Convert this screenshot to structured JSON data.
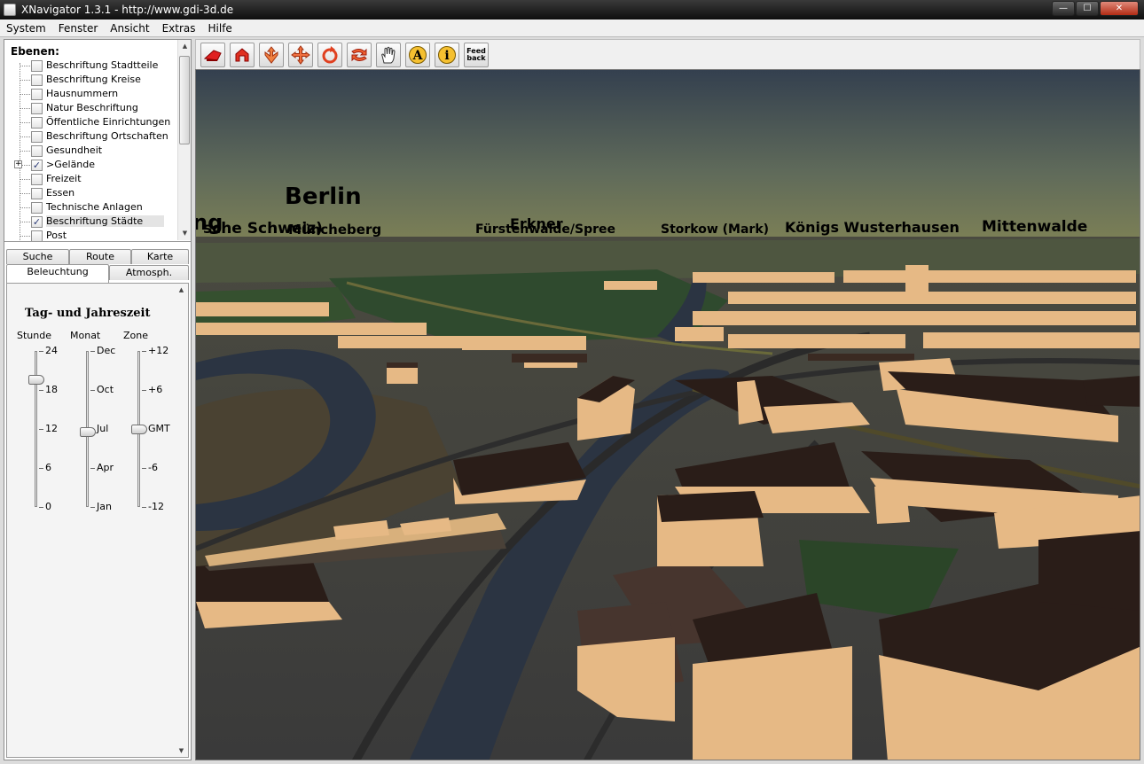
{
  "window": {
    "title": "XNavigator 1.3.1 - http://www.gdi-3d.de",
    "controls": {
      "minimize": "—",
      "maximize": "☐",
      "close": "✕"
    }
  },
  "menu": [
    "System",
    "Fenster",
    "Ansicht",
    "Extras",
    "Hilfe"
  ],
  "layers": {
    "title": "Ebenen:",
    "items": [
      {
        "label": "Beschriftung Stadtteile",
        "checked": false
      },
      {
        "label": "Beschriftung Kreise",
        "checked": false
      },
      {
        "label": "Hausnummern",
        "checked": false
      },
      {
        "label": "Natur Beschriftung",
        "checked": false
      },
      {
        "label": "Öffentliche Einrichtungen",
        "checked": false
      },
      {
        "label": "Beschriftung Ortschaften",
        "checked": false
      },
      {
        "label": "Gesundheit",
        "checked": false
      },
      {
        "label": ">Gelände",
        "checked": true,
        "expandable": true
      },
      {
        "label": "Freizeit",
        "checked": false
      },
      {
        "label": "Essen",
        "checked": false
      },
      {
        "label": "Technische Anlagen",
        "checked": false
      },
      {
        "label": "Beschriftung Städte",
        "checked": true,
        "selected": true
      },
      {
        "label": "Post",
        "checked": false
      }
    ]
  },
  "tabs": {
    "row1": [
      "Suche",
      "Route",
      "Karte"
    ],
    "row2": [
      "Beleuchtung",
      "Atmosph."
    ],
    "active": "Beleuchtung"
  },
  "lighting": {
    "title": "Tag- und Jahreszeit",
    "columns": {
      "hour": {
        "label": "Stunde",
        "ticks": [
          "24",
          "18",
          "12",
          "6",
          "0"
        ],
        "value": 18
      },
      "month": {
        "label": "Monat",
        "ticks": [
          "Dec",
          "Oct",
          "Jul",
          "Apr",
          "Jan"
        ],
        "value": "Jul"
      },
      "zone": {
        "label": "Zone",
        "ticks": [
          "+12",
          "+6",
          "GMT",
          "-6",
          "-12"
        ],
        "value": "GMT"
      }
    }
  },
  "toolbar": {
    "tools": [
      "fly-icon",
      "walk-icon",
      "pan-icon",
      "move-icon",
      "rotate-icon",
      "turn-icon",
      "hand-icon",
      "label-icon",
      "info-icon",
      "feedback-icon"
    ],
    "feedback_label": "Feed back"
  },
  "view": {
    "cities": [
      {
        "name": "Berlin",
        "big": true
      },
      {
        "name": "ng",
        "big": true
      },
      {
        "name": "sche Schweiz)",
        "big": false
      },
      {
        "name": "Müncheberg",
        "big": false
      },
      {
        "name": "Erkner",
        "big": false
      },
      {
        "name": "Fürstenwalde/Spree",
        "big": false
      },
      {
        "name": "Storkow (Mark)",
        "big": false
      },
      {
        "name": "Königs Wusterhausen",
        "big": false
      },
      {
        "name": "Mittenwalde",
        "big": false
      }
    ],
    "colors": {
      "sky_top": "#34404f",
      "sky_horizon": "#7b7f56",
      "ground": "#3d3d3d",
      "building": "#e6b985",
      "roof": "#2a1d18",
      "water": "#2b3442",
      "green": "#2f4a2e"
    }
  }
}
